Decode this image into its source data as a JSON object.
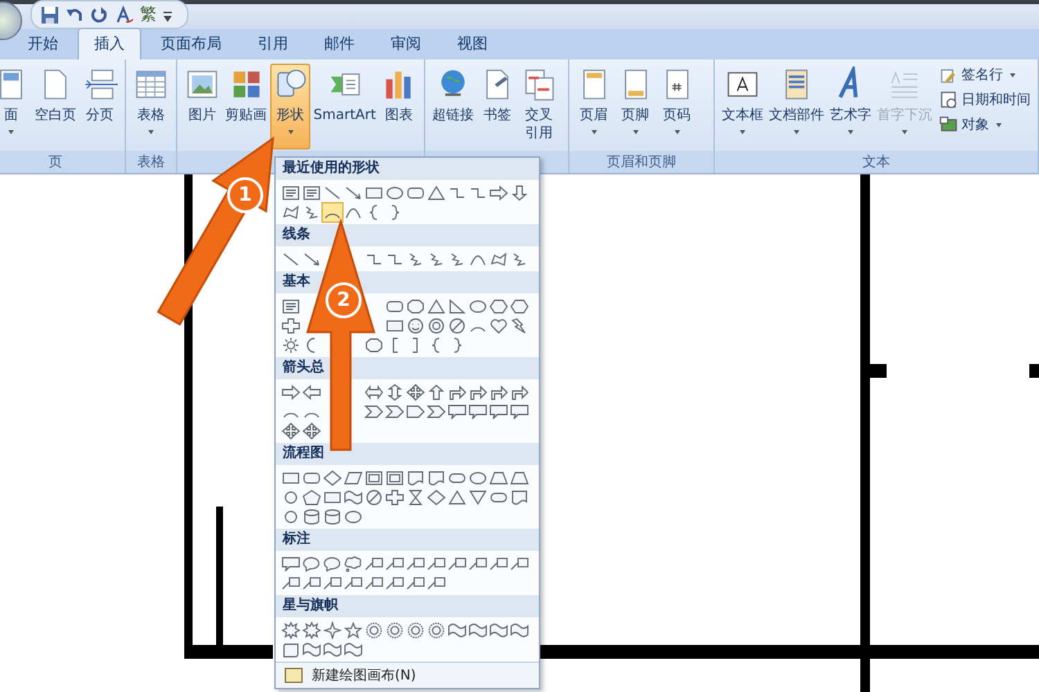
{
  "quick_access": {
    "text_button": "繁"
  },
  "tabs": [
    {
      "label": "开始",
      "selected": false
    },
    {
      "label": "插入",
      "selected": true
    },
    {
      "label": "页面布局",
      "selected": false
    },
    {
      "label": "引用",
      "selected": false
    },
    {
      "label": "邮件",
      "selected": false
    },
    {
      "label": "审阅",
      "selected": false
    },
    {
      "label": "视图",
      "selected": false
    }
  ],
  "ribbon_groups": [
    {
      "label": "页",
      "buttons": [
        {
          "label": "面",
          "dropdown": true,
          "active": false,
          "disabled": false
        },
        {
          "label": "空白页",
          "dropdown": false,
          "active": false,
          "disabled": false
        },
        {
          "label": "分页",
          "dropdown": false,
          "active": false,
          "disabled": false
        }
      ]
    },
    {
      "label": "表格",
      "buttons": [
        {
          "label": "表格",
          "dropdown": true,
          "active": false,
          "disabled": false
        }
      ]
    },
    {
      "buttons": [
        {
          "label": "图片",
          "dropdown": false,
          "active": false,
          "disabled": false
        },
        {
          "label": "剪贴画",
          "dropdown": false,
          "active": false,
          "disabled": false
        },
        {
          "label": "形状",
          "dropdown": true,
          "active": true,
          "disabled": false
        },
        {
          "label": "SmartArt",
          "dropdown": false,
          "active": false,
          "disabled": false
        },
        {
          "label": "图表",
          "dropdown": false,
          "active": false,
          "disabled": false
        }
      ]
    },
    {
      "buttons": [
        {
          "label": "超链接",
          "dropdown": false,
          "active": false,
          "disabled": false
        },
        {
          "label": "书签",
          "dropdown": false,
          "active": false,
          "disabled": false
        },
        {
          "label": "交叉引用",
          "dropdown": false,
          "active": false,
          "disabled": false
        }
      ]
    },
    {
      "label": "页眉和页脚",
      "buttons": [
        {
          "label": "页眉",
          "dropdown": true,
          "active": false,
          "disabled": false
        },
        {
          "label": "页脚",
          "dropdown": true,
          "active": false,
          "disabled": false
        },
        {
          "label": "页码",
          "dropdown": true,
          "active": false,
          "disabled": false
        }
      ]
    },
    {
      "label": "文本",
      "buttons": [
        {
          "label": "文本框",
          "dropdown": true,
          "active": false,
          "disabled": false
        },
        {
          "label": "文档部件",
          "dropdown": true,
          "active": false,
          "disabled": false
        },
        {
          "label": "艺术字",
          "dropdown": true,
          "active": false,
          "disabled": false
        },
        {
          "label": "首字下沉",
          "dropdown": true,
          "active": false,
          "disabled": true
        }
      ],
      "small_buttons": [
        {
          "label": "签名行",
          "dropdown": true
        },
        {
          "label": "日期和时间",
          "dropdown": false
        },
        {
          "label": "对象",
          "dropdown": true
        }
      ]
    }
  ],
  "shapes_menu": {
    "sections": [
      {
        "title": "最近使用的形状",
        "shapes": [
          {
            "selected": false
          },
          {
            "selected": false
          },
          {
            "selected": false
          },
          {
            "selected": false
          },
          {
            "selected": false
          },
          {
            "selected": false
          },
          {
            "selected": false
          },
          {
            "selected": false
          },
          {
            "selected": false
          },
          {
            "selected": false
          },
          {
            "selected": false
          },
          {
            "selected": false
          },
          {
            "selected": false
          },
          {
            "selected": false
          },
          {
            "selected": true
          },
          {
            "selected": false
          },
          {
            "selected": false
          },
          {
            "selected": false
          }
        ]
      },
      {
        "title": "线条"
      },
      {
        "title": "基本"
      },
      {
        "title": "箭头总"
      },
      {
        "title": "流程图"
      },
      {
        "title": "标注"
      },
      {
        "title": "星与旗帜"
      }
    ],
    "footer": "新建绘图画布(N)"
  },
  "annotations": [
    {
      "label": "1"
    },
    {
      "label": "2"
    }
  ]
}
